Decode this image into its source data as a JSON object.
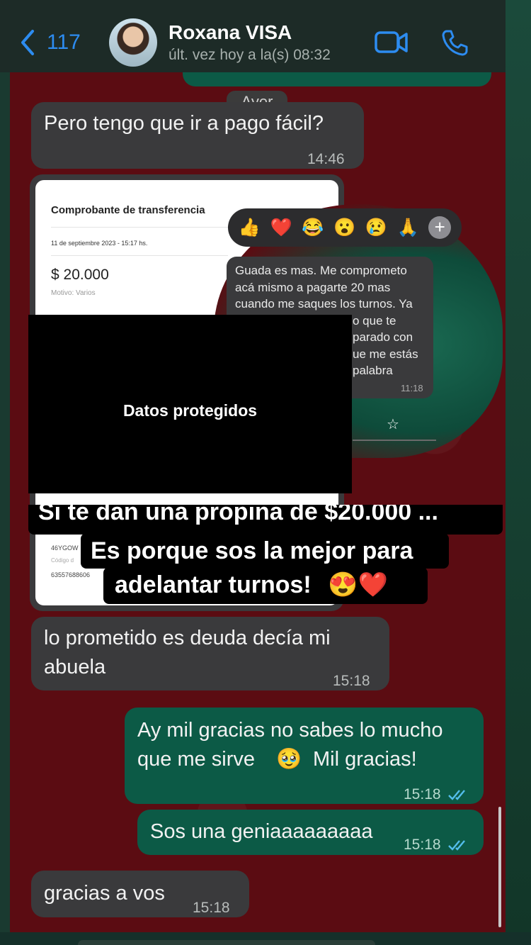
{
  "header": {
    "back_count": "117",
    "contact_name": "Roxana VISA",
    "last_seen": "últ. vez hoy a la(s) 08:32"
  },
  "date_separator": "Ayer",
  "messages": [
    {
      "text": "Pero tengo que ir a pago fácil?",
      "time": "14:46"
    },
    {
      "text_line1": "lo prometido es deuda decía mi",
      "text_line2": "abuela",
      "time": "15:18"
    },
    {
      "text_line1": "Ay mil gracias no sabes lo mucho",
      "text_line2_a": "que me sirve",
      "emoji": "🥹",
      "text_line2_b": "Mil gracias!",
      "time": "15:18"
    },
    {
      "text": "Sos una geniaaaaaaaaa",
      "time": "15:18"
    },
    {
      "text": "gracias a vos",
      "time": "15:18"
    }
  ],
  "receipt": {
    "title": "Comprobante de transferencia",
    "date": "11 de septiembre 2023 - 15:17 hs.",
    "amount": "$ 20.000",
    "motivo": "Motivo: Varios",
    "code": "46YGOW",
    "code_label": "Código d",
    "number": "63557688606"
  },
  "sticker": {
    "reactions": [
      "👍",
      "❤️",
      "😂",
      "😮",
      "😢",
      "🙏"
    ],
    "plus": "+",
    "message_lines": [
      "Guada es mas. Me comprometo",
      "acá mismo a pagarte 20 mas",
      "cuando me saques los turnos. Ya",
      "o que te",
      "parado con",
      "ue me estás",
      "palabra"
    ],
    "time": "11:18"
  },
  "overlay": {
    "protected_label": "Datos protegidos",
    "caption_line1": "Si te dan una propina de $20.000 ...",
    "caption_line2": "Es porque sos la mejor para",
    "caption_line3": "adelantar turnos!",
    "caption_emojis": "😍❤️"
  },
  "colors": {
    "chat_background": "#5b0c12",
    "incoming_bubble": "#3a3a3c",
    "outgoing_bubble": "#0c5a46",
    "accent_blue": "#2d8cf0"
  }
}
